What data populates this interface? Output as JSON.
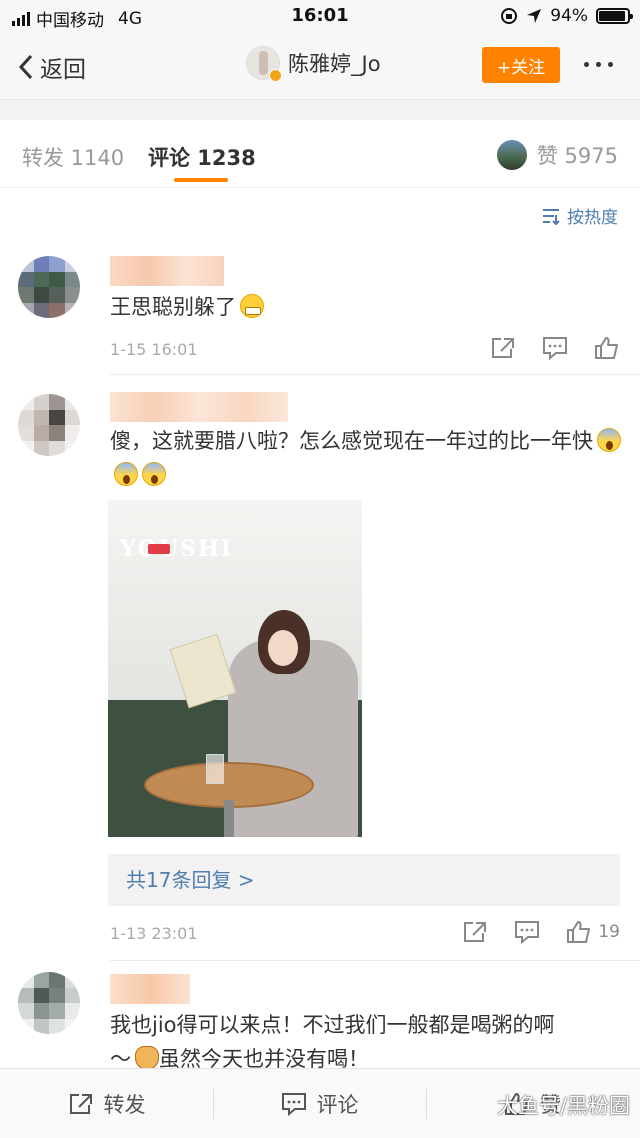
{
  "status_bar": {
    "carrier": "中国移动",
    "network": "4G",
    "time": "16:01",
    "battery": "94%",
    "battery_level": 0.94
  },
  "nav": {
    "back_label": "返回",
    "user_name": "陈雅婷_Jo",
    "follow_label": "+关注"
  },
  "tabs": {
    "repost": "转发 1140",
    "comments": "评论 1238",
    "likes": "赞 5975"
  },
  "sort_label": "按热度",
  "comments": [
    {
      "text": "王思聪别躲了",
      "emoji": "grin-icon",
      "time": "1-15 16:01"
    },
    {
      "text": "傻，这就要腊八啦？怎么感觉现在一年过的比一年快",
      "emoji": "scream-icon",
      "image_brand": "YOUSHI",
      "replies_label": "共17条回复 >",
      "time": "1-13 23:01",
      "like_count": "19"
    },
    {
      "text_part1": "我也jio得可以来点！不过我们一般都是喝粥的啊",
      "text_part2": "～",
      "text_part3": "虽然今天也并没有喝！"
    }
  ],
  "bottom_bar": {
    "repost": "转发",
    "comment": "评论",
    "like": "赞"
  },
  "watermark": "大鱼号/黑粉圈",
  "colors": {
    "accent": "#ff8200",
    "link": "#507daf"
  }
}
